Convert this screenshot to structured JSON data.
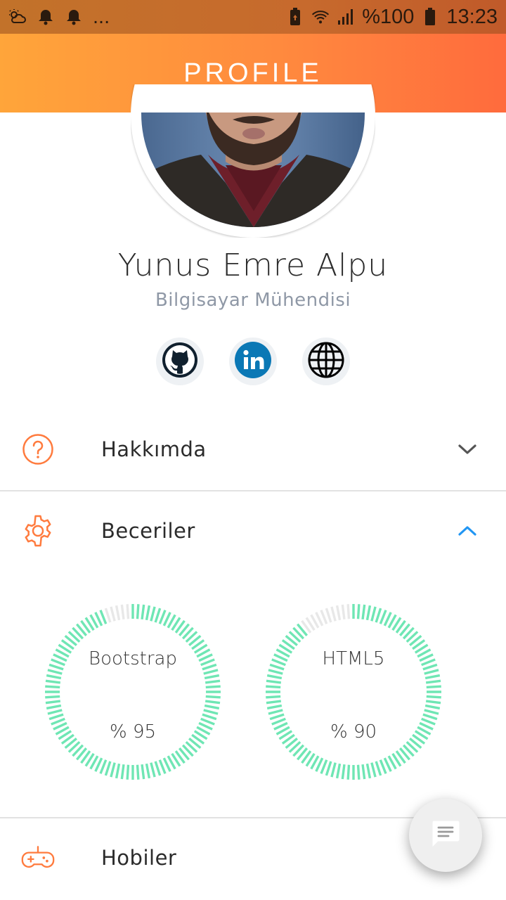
{
  "status_bar": {
    "battery_text": "%100",
    "time": "13:23",
    "more": "..."
  },
  "header": {
    "title": "PROFILE"
  },
  "profile": {
    "name": "Yunus Emre Alpu",
    "title": "Bilgisayar Mühendisi"
  },
  "social": [
    {
      "icon": "github-icon"
    },
    {
      "icon": "linkedin-icon"
    },
    {
      "icon": "globe-icon"
    }
  ],
  "sections": {
    "about": {
      "label": "Hakkımda",
      "expanded": false
    },
    "skills": {
      "label": "Beceriler",
      "expanded": true
    },
    "hobbies": {
      "label": "Hobiler",
      "expanded": false
    }
  },
  "skills": [
    {
      "name": "Bootstrap",
      "percent_text": "% 95",
      "value": 95
    },
    {
      "name": "HTML5",
      "percent_text": "% 90",
      "value": 90
    }
  ],
  "colors": {
    "accent": "#ff7b3e",
    "gauge": "#6fe6b4",
    "gauge_track": "#e8e8e8",
    "chevron_active": "#2196f3",
    "chevron": "#555555"
  }
}
